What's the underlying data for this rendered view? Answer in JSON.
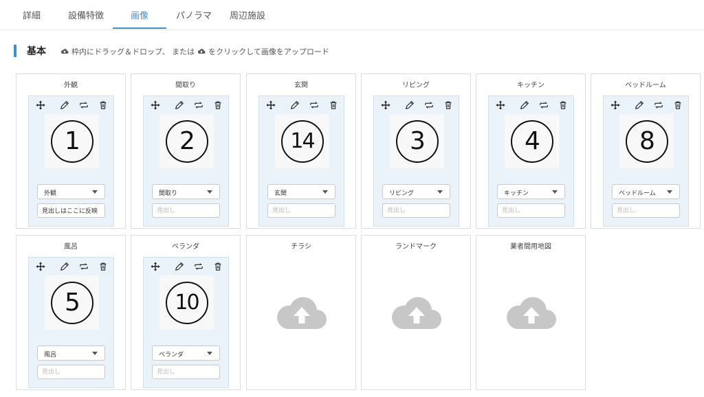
{
  "tabs": [
    {
      "label": "詳細"
    },
    {
      "label": "設備特徴"
    },
    {
      "label": "画像"
    },
    {
      "label": "パノラマ"
    },
    {
      "label": "周辺施設"
    }
  ],
  "section": {
    "title": "基本",
    "hint_part1": "枠内にドラッグ＆ドロップ、 または",
    "hint_part2": "をクリックして画像をアップロード"
  },
  "icons": {
    "move": "move-arrows-icon",
    "edit": "pencil-icon",
    "replace": "swap-icon",
    "delete": "trash-icon",
    "upload": "cloud-upload-icon"
  },
  "colors": {
    "accent": "#3a8fd0",
    "inner_bg": "#eaf2fa",
    "upload_cloud": "#c7c7c7"
  },
  "cards": [
    {
      "label": "外観",
      "number": "1",
      "select": "外観",
      "heading_value": "見出しはここに反映",
      "heading_placeholder": "見出し"
    },
    {
      "label": "間取り",
      "number": "2",
      "select": "間取り",
      "heading_value": "",
      "heading_placeholder": "見出し"
    },
    {
      "label": "玄関",
      "number": "14",
      "select": "玄関",
      "heading_value": "",
      "heading_placeholder": "見出し"
    },
    {
      "label": "リビング",
      "number": "3",
      "select": "リビング",
      "heading_value": "",
      "heading_placeholder": "見出し"
    },
    {
      "label": "キッチン",
      "number": "4",
      "select": "キッチン",
      "heading_value": "",
      "heading_placeholder": "見出し"
    },
    {
      "label": "ベッドルーム",
      "number": "8",
      "select": "ベッドルーム",
      "heading_value": "",
      "heading_placeholder": "見出し"
    },
    {
      "label": "風呂",
      "number": "5",
      "select": "風呂",
      "heading_value": "",
      "heading_placeholder": "見出し"
    },
    {
      "label": "ベランダ",
      "number": "10",
      "select": "ベランダ",
      "heading_value": "",
      "heading_placeholder": "見出し"
    }
  ],
  "empty_cards": [
    {
      "label": "チラシ"
    },
    {
      "label": "ランドマーク"
    },
    {
      "label": "業者間用地図"
    }
  ]
}
